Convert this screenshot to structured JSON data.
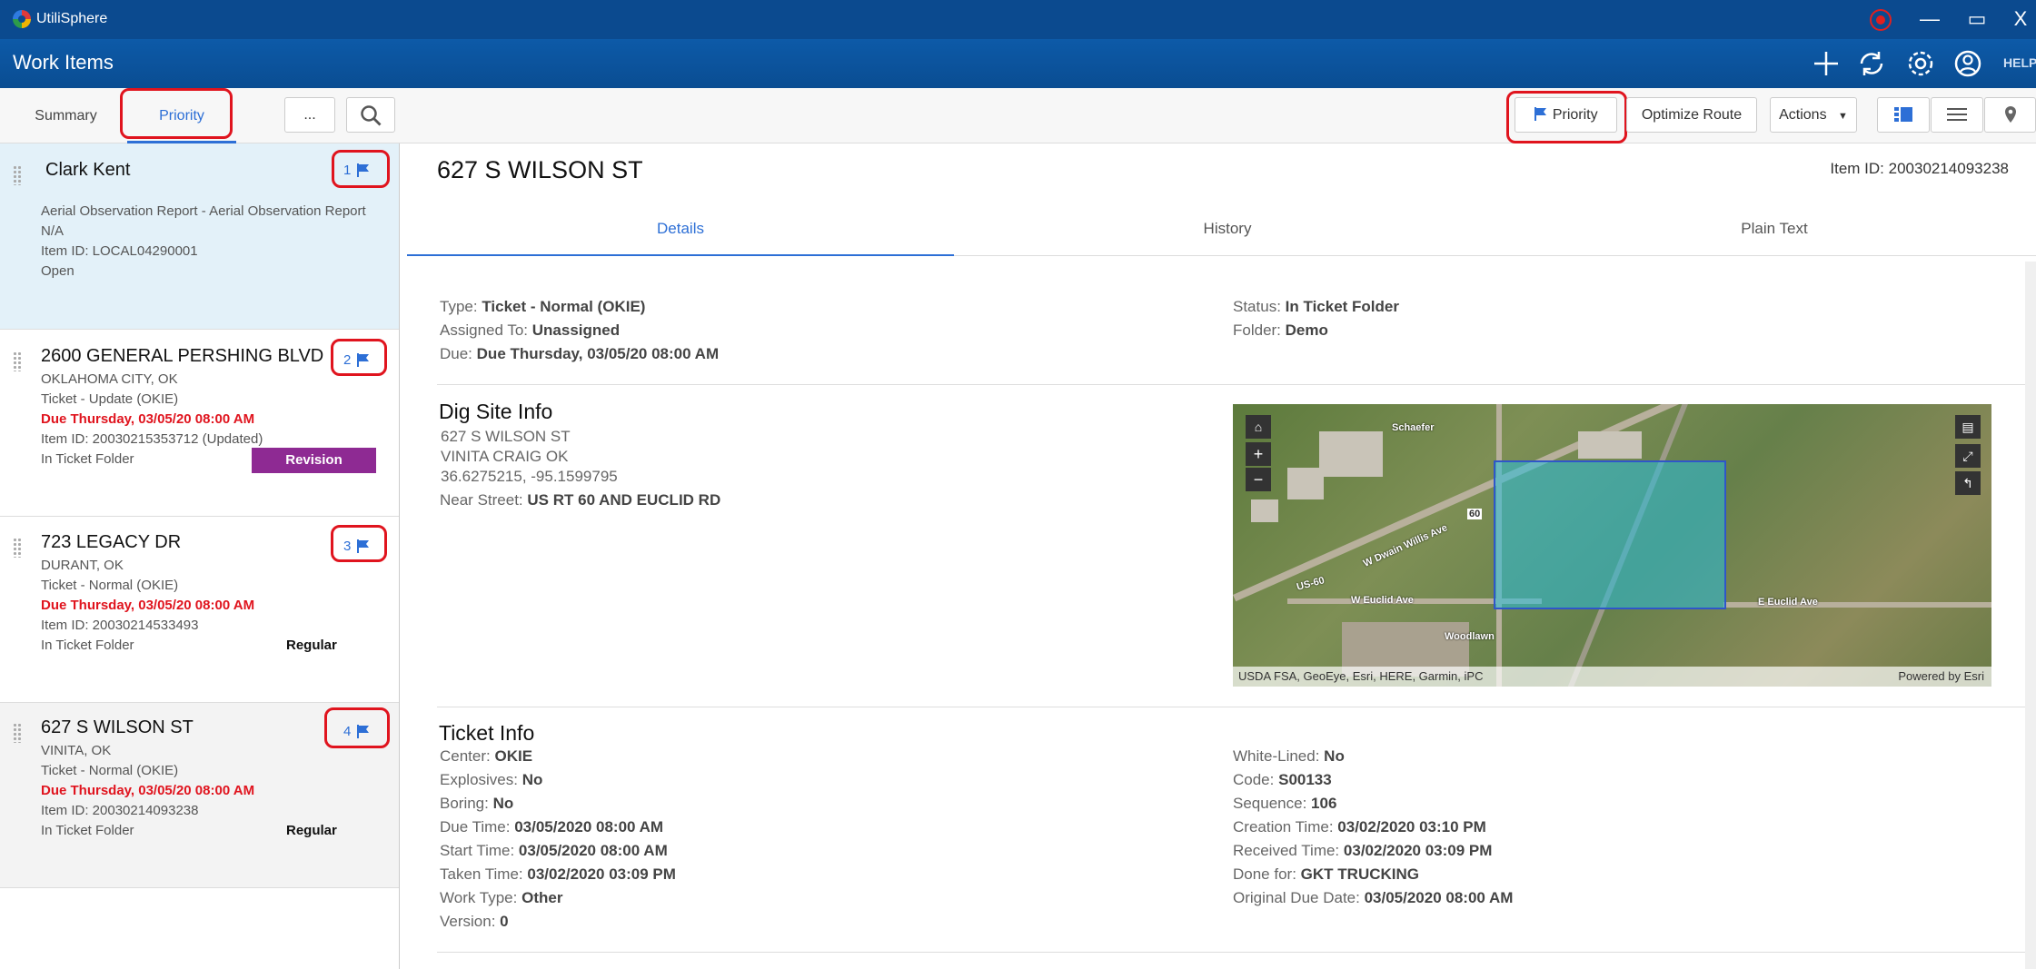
{
  "window": {
    "app_title": "UtiliSphere",
    "min_label": "—",
    "max_label": "▭",
    "close_label": "X"
  },
  "header": {
    "page_title": "Work Items",
    "help_label": "HELP"
  },
  "toolbar": {
    "tabs": [
      {
        "label": "Summary"
      },
      {
        "label": "Priority"
      }
    ],
    "more_label": "...",
    "priority_label": "Priority",
    "optimize_label": "Optimize Route",
    "actions_label": "Actions"
  },
  "list": [
    {
      "title": "Clark Kent",
      "rank": "1",
      "lines": [
        "Aerial Observation Report - Aerial Observation Report",
        "N/A",
        "Item ID: LOCAL04290001",
        "Open"
      ]
    },
    {
      "title": "2600 GENERAL PERSHING BLVD",
      "rank": "2",
      "city": "OKLAHOMA CITY, OK",
      "type": "Ticket - Update (OKIE)",
      "due": "Due Thursday, 03/05/20 08:00 AM",
      "item": "Item ID: 20030215353712 (Updated)",
      "status": "In Ticket Folder",
      "badge": "Revision"
    },
    {
      "title": "723 LEGACY DR",
      "rank": "3",
      "city": "DURANT, OK",
      "type": "Ticket - Normal (OKIE)",
      "due": "Due Thursday, 03/05/20 08:00 AM",
      "item": "Item ID: 20030214533493",
      "status": "In Ticket Folder",
      "badge": "Regular"
    },
    {
      "title": "627 S WILSON ST",
      "rank": "4",
      "city": "VINITA, OK",
      "type": "Ticket - Normal (OKIE)",
      "due": "Due Thursday, 03/05/20 08:00 AM",
      "item": "Item ID: 20030214093238",
      "status": "In Ticket Folder",
      "badge": "Regular"
    }
  ],
  "detail": {
    "title": "627 S WILSON ST",
    "item_id": "Item ID: 20030214093238",
    "tabs": [
      "Details",
      "History",
      "Plain Text"
    ],
    "summary_left": [
      {
        "label": "Type:",
        "value": "Ticket - Normal (OKIE)"
      },
      {
        "label": "Assigned To:",
        "value": "Unassigned"
      },
      {
        "label": "Due:",
        "value": "Due Thursday, 03/05/20 08:00 AM"
      }
    ],
    "summary_right": [
      {
        "label": "Status:",
        "value": "In Ticket Folder"
      },
      {
        "label": "Folder:",
        "value": "Demo"
      }
    ],
    "dig_site": {
      "title": "Dig Site Info",
      "lines": [
        "627 S WILSON ST",
        "VINITA CRAIG OK",
        "36.6275215, -95.1599795"
      ],
      "near_label": "Near Street:",
      "near_value": "US RT 60 AND EUCLID RD",
      "map_attribution": "USDA FSA, GeoEye, Esri, HERE, Garmin, iPC",
      "map_powered": "Powered by Esri",
      "map_labels": [
        "Schaefer",
        "W Dwain Willis Ave",
        "W Euclid Ave",
        "US-60",
        "Woodlawn",
        "E Euclid Ave",
        "60"
      ]
    },
    "ticket_info": {
      "title": "Ticket Info",
      "left": [
        {
          "label": "Center:",
          "value": "OKIE"
        },
        {
          "label": "Explosives:",
          "value": "No"
        },
        {
          "label": "Boring:",
          "value": "No"
        },
        {
          "label": "Due Time:",
          "value": "03/05/2020 08:00 AM"
        },
        {
          "label": "Start Time:",
          "value": "03/05/2020 08:00 AM"
        },
        {
          "label": "Taken Time:",
          "value": "03/02/2020 03:09 PM"
        },
        {
          "label": "Work Type:",
          "value": "Other"
        },
        {
          "label": "Version:",
          "value": "0"
        }
      ],
      "right": [
        {
          "label": "White-Lined:",
          "value": "No"
        },
        {
          "label": "Code:",
          "value": "S00133"
        },
        {
          "label": "Sequence:",
          "value": "106"
        },
        {
          "label": "Creation Time:",
          "value": "03/02/2020 03:10 PM"
        },
        {
          "label": "Received Time:",
          "value": "03/02/2020 03:09 PM"
        },
        {
          "label": "Done for:",
          "value": "GKT TRUCKING"
        },
        {
          "label": "Original Due Date:",
          "value": "03/05/2020 08:00 AM"
        }
      ]
    }
  },
  "colors": {
    "accent": "#2d6fd6",
    "header": "#0b4a8f",
    "due": "#e0141e",
    "revision": "#8e2a93",
    "highlight": "#e0141e"
  }
}
